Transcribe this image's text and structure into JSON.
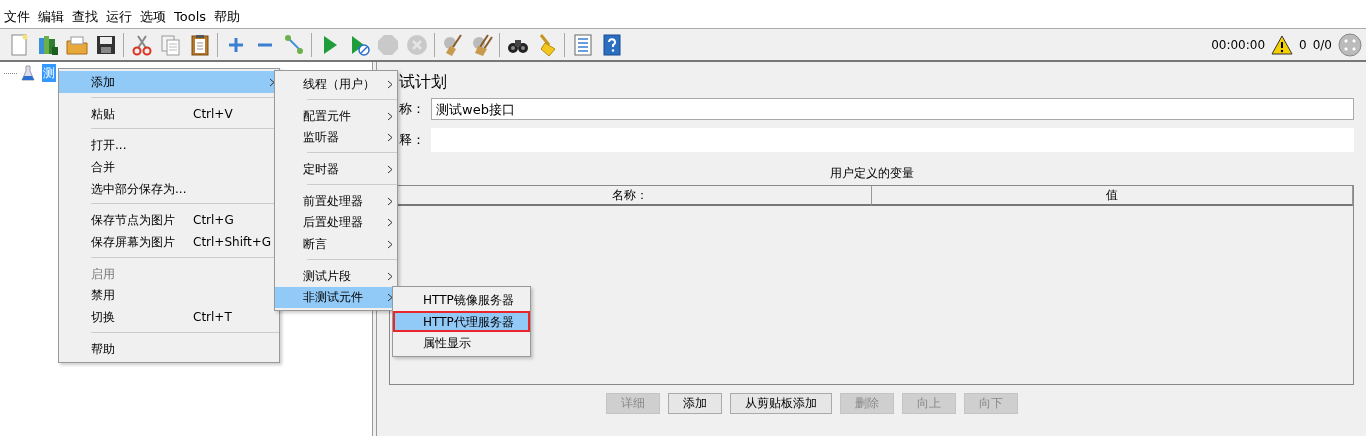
{
  "menubar": [
    "文件",
    "编辑",
    "查找",
    "运行",
    "选项",
    "Tools",
    "帮助"
  ],
  "toolbar": [
    {
      "kind": "new"
    },
    {
      "kind": "templates"
    },
    {
      "kind": "open"
    },
    {
      "kind": "save"
    },
    {
      "kind": "separator"
    },
    {
      "kind": "cut"
    },
    {
      "kind": "copy"
    },
    {
      "kind": "paste"
    },
    {
      "kind": "separator"
    },
    {
      "kind": "expand"
    },
    {
      "kind": "collapse"
    },
    {
      "kind": "toggle"
    },
    {
      "kind": "separator"
    },
    {
      "kind": "start"
    },
    {
      "kind": "start-no-timers"
    },
    {
      "kind": "stop",
      "disabled": true
    },
    {
      "kind": "shutdown",
      "disabled": true
    },
    {
      "kind": "separator"
    },
    {
      "kind": "clear"
    },
    {
      "kind": "clear-all"
    },
    {
      "kind": "separator"
    },
    {
      "kind": "search"
    },
    {
      "kind": "reset-search"
    },
    {
      "kind": "separator"
    },
    {
      "kind": "functions"
    },
    {
      "kind": "help"
    }
  ],
  "status": {
    "timer": "00:00:00",
    "warnings": "0",
    "threads": "0/0"
  },
  "tree": [
    {
      "label": "测",
      "selected": true
    }
  ],
  "context_menu": [
    {
      "kind": "item",
      "label": "添加",
      "submenu": true,
      "selected": true,
      "disabled": false
    },
    {
      "kind": "separator"
    },
    {
      "kind": "item",
      "label": "粘贴",
      "shortcut": "Ctrl+V",
      "submenu": false,
      "selected": false,
      "disabled": false
    },
    {
      "kind": "separator"
    },
    {
      "kind": "item",
      "label": "打开...",
      "submenu": false,
      "selected": false,
      "disabled": false
    },
    {
      "kind": "item",
      "label": "合并",
      "submenu": false,
      "selected": false,
      "disabled": false
    },
    {
      "kind": "item",
      "label": "选中部分保存为...",
      "submenu": false,
      "selected": false,
      "disabled": false
    },
    {
      "kind": "separator"
    },
    {
      "kind": "item",
      "label": "保存节点为图片",
      "shortcut": "Ctrl+G",
      "submenu": false,
      "selected": false,
      "disabled": false
    },
    {
      "kind": "item",
      "label": "保存屏幕为图片",
      "shortcut": "Ctrl+Shift+G",
      "submenu": false,
      "selected": false,
      "disabled": false
    },
    {
      "kind": "separator"
    },
    {
      "kind": "item",
      "label": "启用",
      "submenu": false,
      "selected": false,
      "disabled": true
    },
    {
      "kind": "item",
      "label": "禁用",
      "submenu": false,
      "selected": false,
      "disabled": false
    },
    {
      "kind": "item",
      "label": "切换",
      "shortcut": "Ctrl+T",
      "submenu": false,
      "selected": false,
      "disabled": false
    },
    {
      "kind": "separator"
    },
    {
      "kind": "item",
      "label": "帮助",
      "submenu": false,
      "selected": false,
      "disabled": false
    }
  ],
  "add_submenu": [
    {
      "kind": "item",
      "label": "线程（用户）",
      "submenu": true,
      "selected": false
    },
    {
      "kind": "separator"
    },
    {
      "kind": "item",
      "label": "配置元件",
      "submenu": true,
      "selected": false
    },
    {
      "kind": "item",
      "label": "监听器",
      "submenu": true,
      "selected": false
    },
    {
      "kind": "separator"
    },
    {
      "kind": "item",
      "label": "定时器",
      "submenu": true,
      "selected": false
    },
    {
      "kind": "separator"
    },
    {
      "kind": "item",
      "label": "前置处理器",
      "submenu": true,
      "selected": false
    },
    {
      "kind": "item",
      "label": "后置处理器",
      "submenu": true,
      "selected": false
    },
    {
      "kind": "item",
      "label": "断言",
      "submenu": true,
      "selected": false
    },
    {
      "kind": "separator"
    },
    {
      "kind": "item",
      "label": "测试片段",
      "submenu": true,
      "selected": false
    },
    {
      "kind": "item",
      "label": "非测试元件",
      "submenu": true,
      "selected": true
    }
  ],
  "non_test_submenu": [
    {
      "label": "HTTP镜像服务器",
      "selected": false,
      "annotated": false
    },
    {
      "label": "HTTP代理服务器",
      "selected": true,
      "annotated": true
    },
    {
      "label": "属性显示",
      "selected": false,
      "annotated": false
    }
  ],
  "panel": {
    "title": "试计划",
    "name_label": "称：",
    "name_value": "测试web接口",
    "comment_label": "释：",
    "variables_title": "用户定义的变量",
    "columns": [
      "名称：",
      "值"
    ],
    "buttons": [
      {
        "label": "详细",
        "disabled": true
      },
      {
        "label": "添加",
        "disabled": false
      },
      {
        "label": "从剪贴板添加",
        "disabled": false
      },
      {
        "label": "删除",
        "disabled": true
      },
      {
        "label": "向上",
        "disabled": true
      },
      {
        "label": "向下",
        "disabled": true
      }
    ]
  }
}
